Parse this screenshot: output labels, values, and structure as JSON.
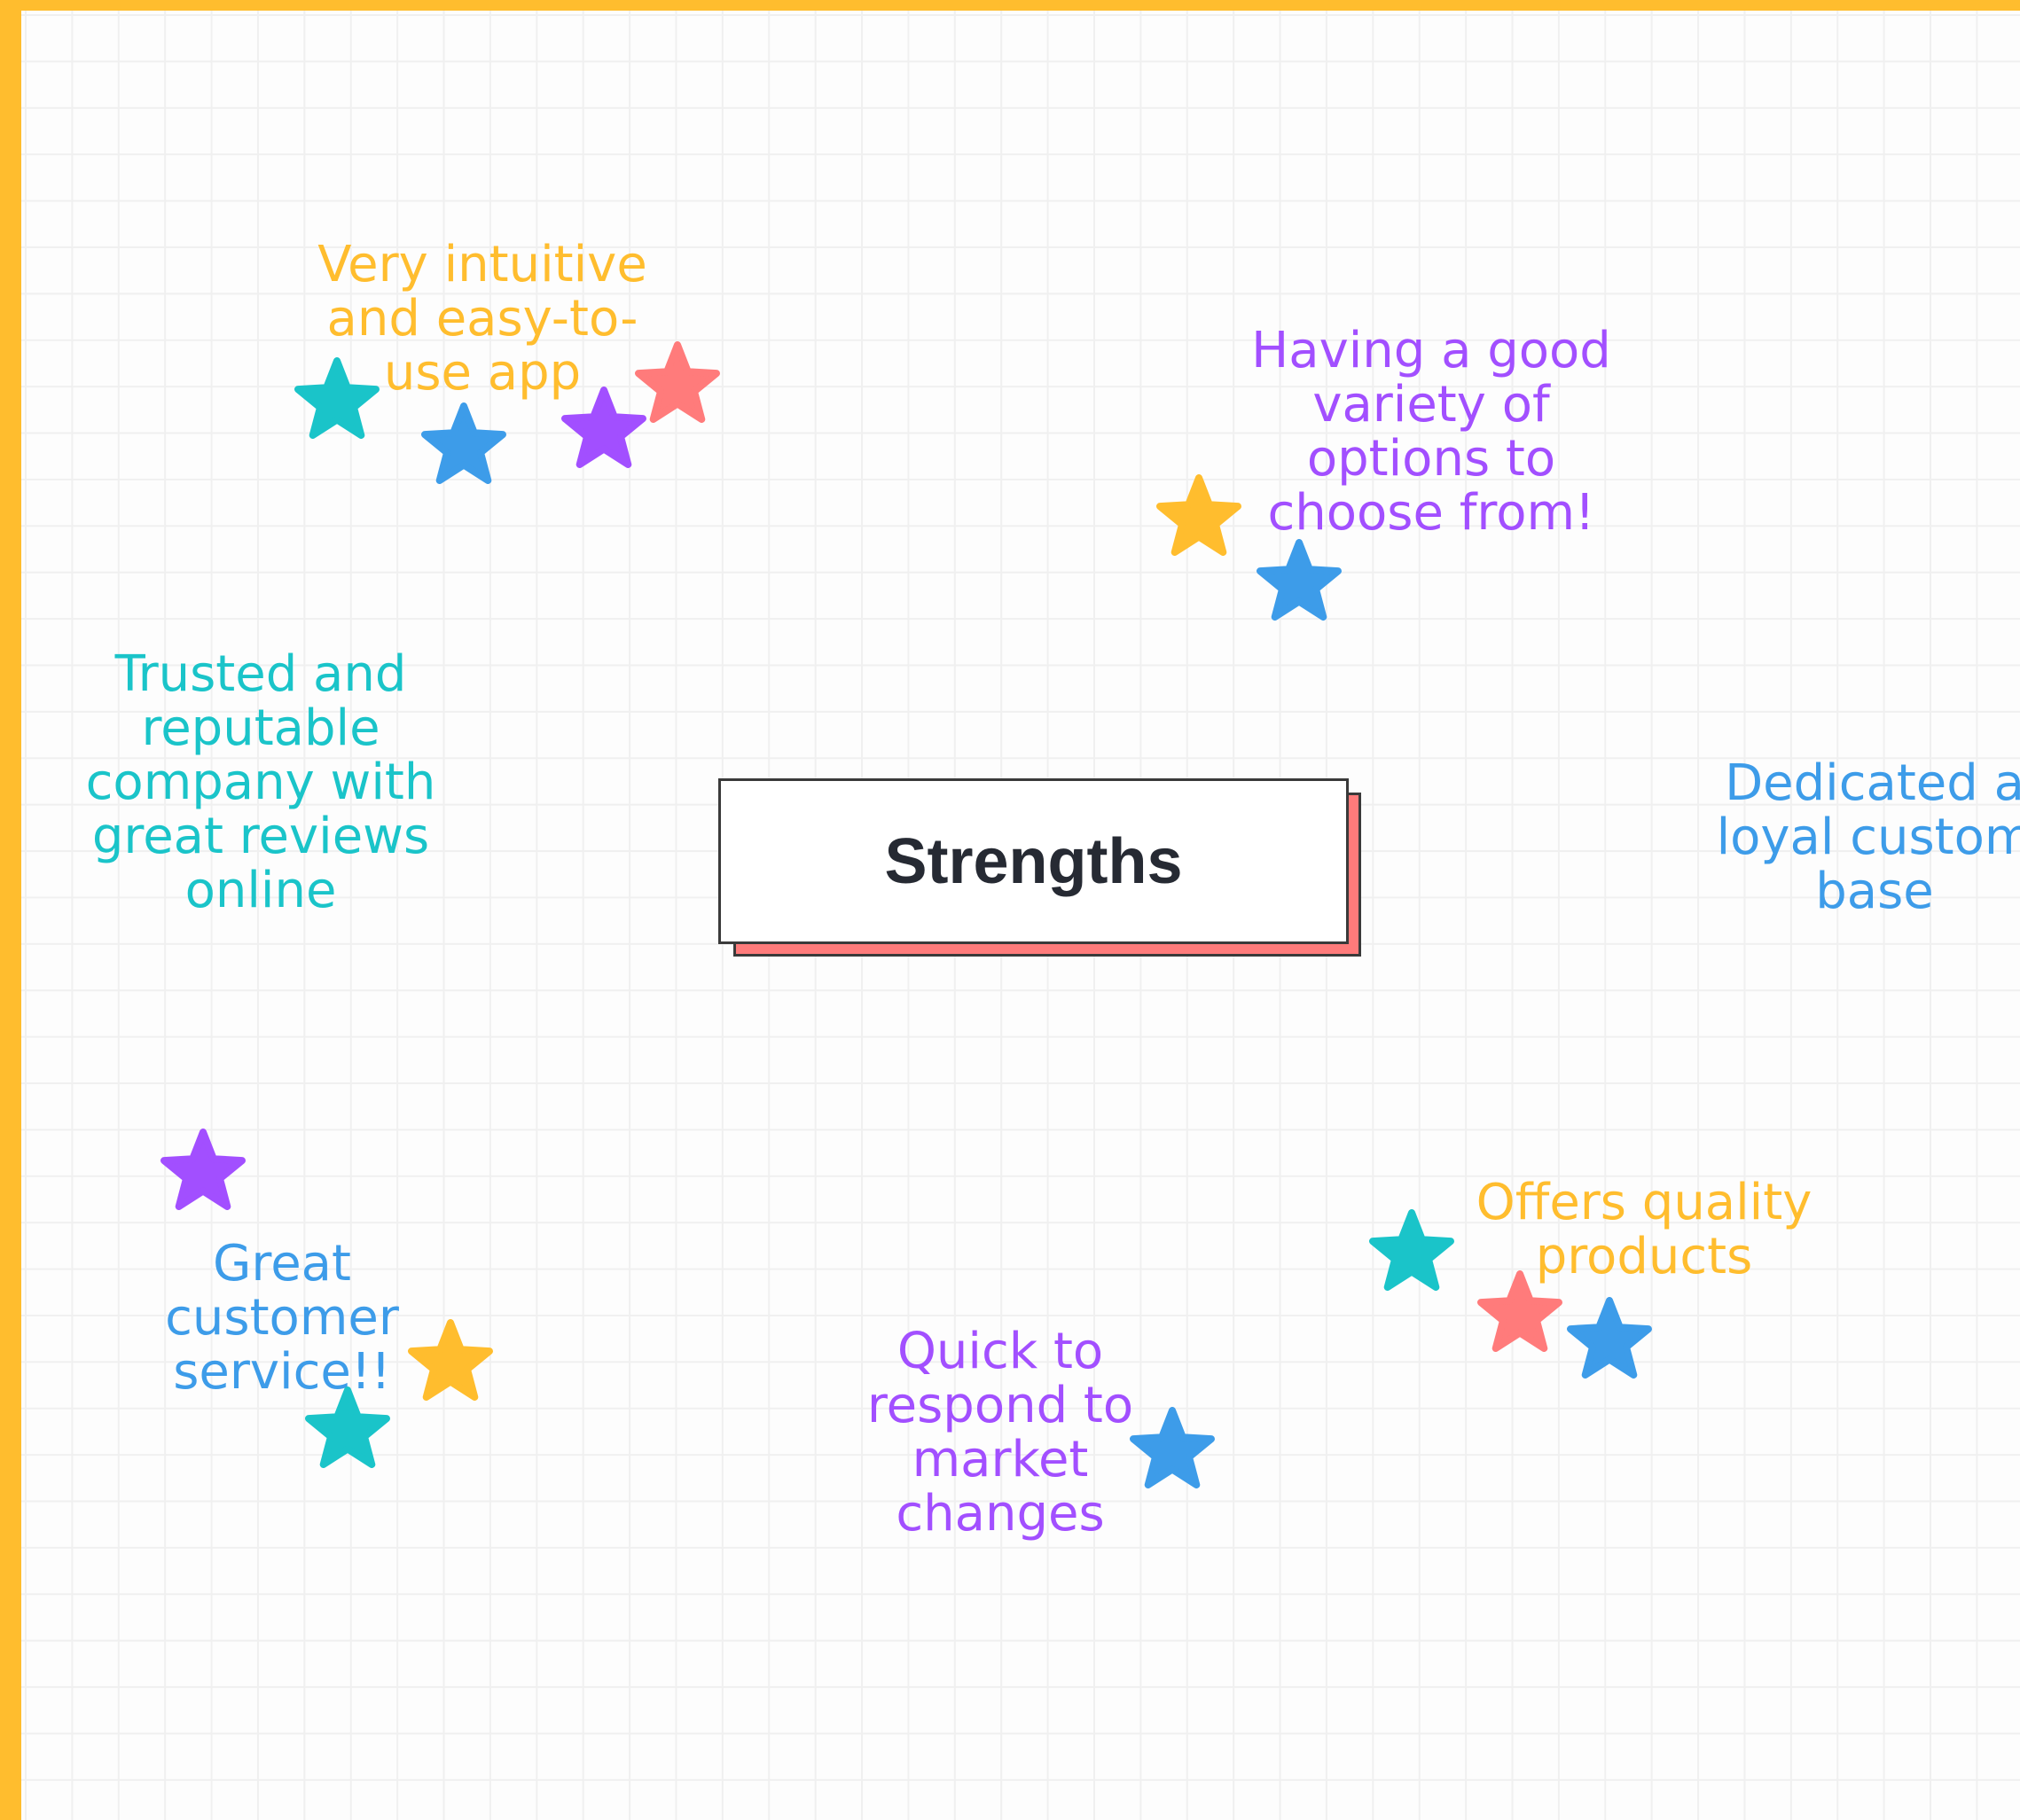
{
  "colors": {
    "frame": "#FFBD2E",
    "yellow": "#FFBD2E",
    "purple": "#A24FFF",
    "teal": "#1AC4C9",
    "blue": "#3D9CE9",
    "pink": "#FF7B7B",
    "title_text": "#262a33"
  },
  "center": {
    "title": "Strengths"
  },
  "notes": {
    "intuitive_app": "Very intuitive\nand easy-to-\nuse app",
    "variety": "Having a good\nvariety of\noptions to\nchoose from!",
    "trusted": "Trusted and\nreputable\ncompany with\ngreat reviews\nonline",
    "loyal": "Dedicated a\nloyal custom\nbase",
    "service": "Great\ncustomer\nservice!!",
    "quick": "Quick to\nrespond to\nmarket\nchanges",
    "quality": "Offers quality\nproducts"
  },
  "star_icon": "star-icon",
  "stars": [
    {
      "color": "teal"
    },
    {
      "color": "blue"
    },
    {
      "color": "purple"
    },
    {
      "color": "pink"
    },
    {
      "color": "yellow"
    },
    {
      "color": "blue"
    },
    {
      "color": "purple"
    },
    {
      "color": "yellow"
    },
    {
      "color": "teal"
    },
    {
      "color": "blue"
    },
    {
      "color": "teal"
    },
    {
      "color": "pink"
    },
    {
      "color": "blue"
    }
  ]
}
